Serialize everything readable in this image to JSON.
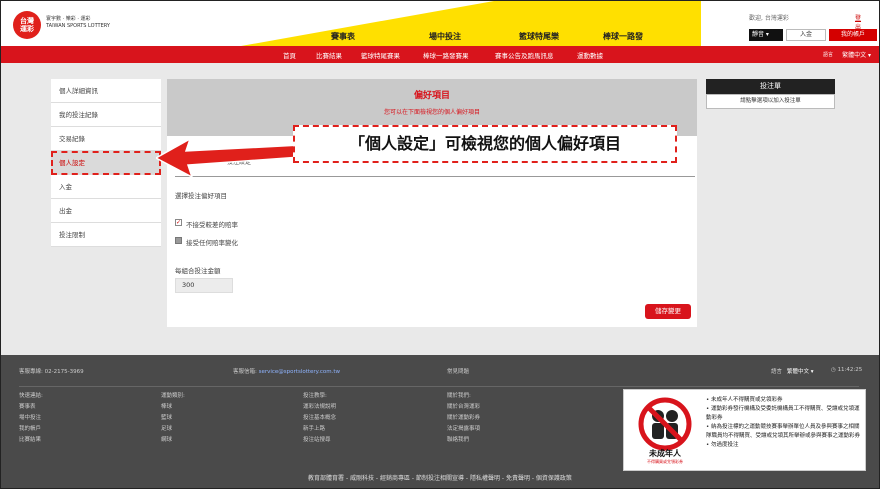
{
  "header": {
    "logo_text": "台灣彩",
    "logo_caption_zh": "寰宇數 · 樂彩 · 運彩",
    "logo_caption_en": "TAIWAN SPORTS LOTTERY",
    "main_nav": [
      "賽事表",
      "場中投注",
      "籃球特尾樂",
      "棒球一路發"
    ],
    "welcome": "歡迎, 台灣運彩",
    "logout": "登出",
    "select_label": "靜音",
    "deposit_label": "入金",
    "account_label": "我的帳戶"
  },
  "subnav": {
    "items": [
      "首頁",
      "比賽結果",
      "籃球特尾賽果",
      "棒球一路發賽果",
      "賽事公告及跑馬訊息",
      "運動數據"
    ],
    "small_label": "語言",
    "language": "繁體中文 ▾"
  },
  "sidebar": {
    "items": [
      {
        "label": "個人詳細資訊"
      },
      {
        "label": "我的投注紀錄"
      },
      {
        "label": "交易紀錄"
      },
      {
        "label": "個人設定"
      },
      {
        "label": "入金"
      },
      {
        "label": "出金"
      },
      {
        "label": "投注限制"
      }
    ]
  },
  "panel": {
    "title": "偏好項目",
    "subtitle": "您可以在下面檢視您的個人偏好項目",
    "section_title": "投注設定",
    "choose_label": "選擇投注偏好項目",
    "options": [
      {
        "label": "不接受較差的賠率",
        "checked": true
      },
      {
        "label": "接受任何賠率變化",
        "checked": false
      }
    ],
    "amount_label": "每組合投注金額",
    "amount_value": "300",
    "save_label": "儲存變更"
  },
  "slip": {
    "title": "投注單",
    "body": "請點擊選項以加入投注單"
  },
  "callout": {
    "text": "「個人設定」可檢視您的個人偏好項目"
  },
  "footer": {
    "hotline": "客服專線: 02-2175-3969",
    "email_label": "客服信箱:",
    "email": "service@sportslottery.com.tw",
    "faq": "常見問題",
    "lang_label": "語言",
    "lang_value": "繁體中文 ▾",
    "time": "11:42:25",
    "col1_title": "快速連結:",
    "col1": [
      "賽事表",
      "場中投注",
      "我的帳戶",
      "比賽結果"
    ],
    "col2_title": "運動類別:",
    "col2": [
      "棒球",
      "籃球",
      "足球",
      "網球"
    ],
    "col3_title": "投注教學:",
    "col3": [
      "運彩法規說明",
      "投注基本概念",
      "新手上路",
      "投注站搜尋"
    ],
    "col4_title": "關於我們:",
    "col4": [
      "關於台灣運彩",
      "關於運動彩券",
      "法定揭露事項",
      "聯絡我們"
    ],
    "warn_title": "未成年人",
    "warn_subtitle": "不得購買或兌領彩券",
    "warn_items": [
      "未成年人不得購買或兌領彩券",
      "運動彩券發行機構及受委託機構員工不得購買、受讓或兌領運動彩券",
      "納為投注標的之運動競技賽事舉辦單位人員及參與賽事之相關隊職員均不得購買、受讓或兌領其所舉辦或參與賽事之運動彩券",
      "勿過度投注"
    ],
    "bottom_links": "教育部體育署 - 威剛科技 - 經銷商專區 - 節制投注相關宣導 - 隱私權聲明 - 免責聲明 - 個資保護政策"
  }
}
